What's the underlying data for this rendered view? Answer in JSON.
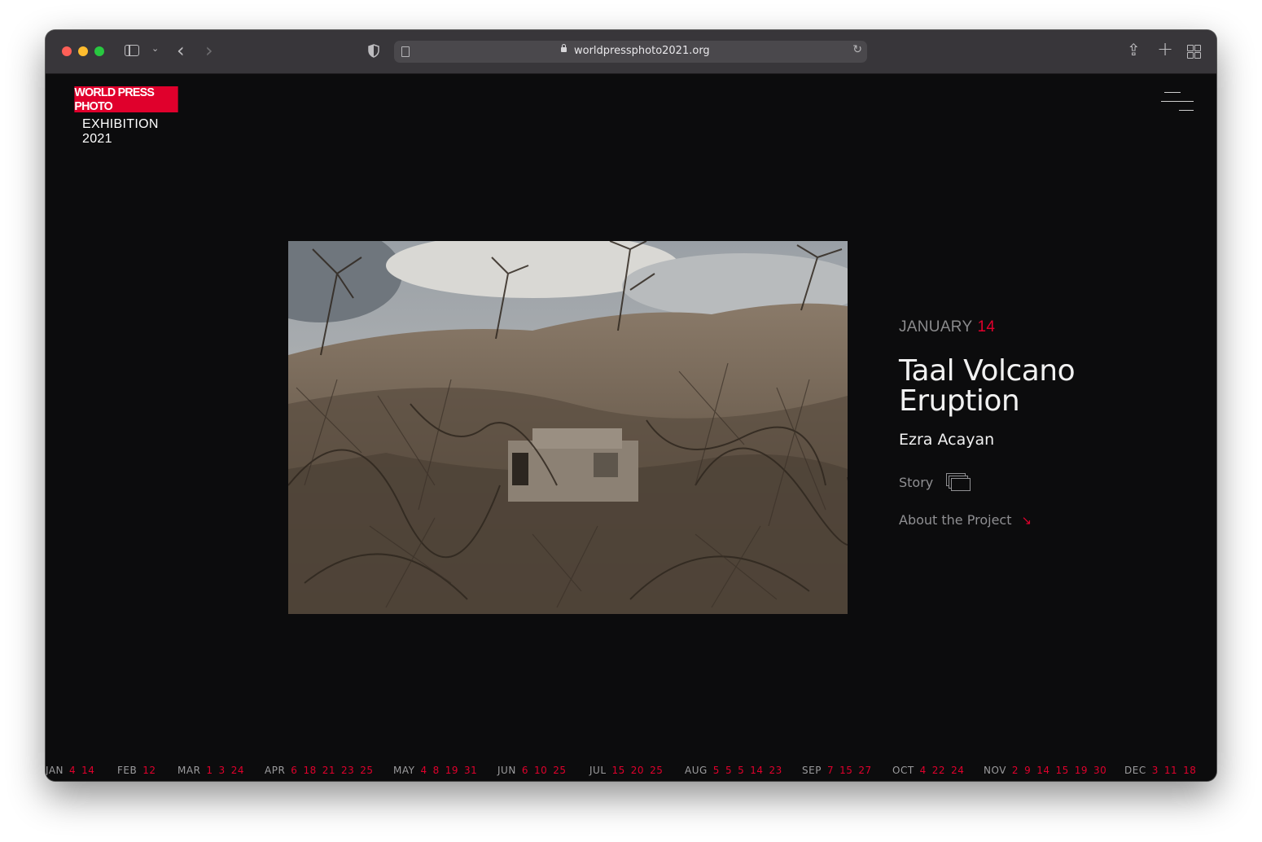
{
  "browser": {
    "url": "worldpressphoto2021.org"
  },
  "logo": {
    "brand": "WORLD PRESS PHOTO",
    "line1": "EXHIBITION",
    "line2": "2021"
  },
  "feature": {
    "month": "JANUARY",
    "day": "14",
    "title_line1": "Taal Volcano",
    "title_line2": "Eruption",
    "author": "Ezra Acayan",
    "story_label": "Story",
    "about_label": "About the Project"
  },
  "timeline": [
    {
      "month": "JAN",
      "days": [
        "4",
        "14"
      ]
    },
    {
      "month": "FEB",
      "days": [
        "12"
      ]
    },
    {
      "month": "MAR",
      "days": [
        "1",
        "3",
        "24"
      ]
    },
    {
      "month": "APR",
      "days": [
        "6",
        "18",
        "21",
        "23",
        "25"
      ]
    },
    {
      "month": "MAY",
      "days": [
        "4",
        "8",
        "19",
        "31"
      ]
    },
    {
      "month": "JUN",
      "days": [
        "6",
        "10",
        "25"
      ]
    },
    {
      "month": "JUL",
      "days": [
        "15",
        "20",
        "25"
      ]
    },
    {
      "month": "AUG",
      "days": [
        "5",
        "5",
        "5",
        "14",
        "23"
      ]
    },
    {
      "month": "SEP",
      "days": [
        "7",
        "15",
        "27"
      ]
    },
    {
      "month": "OCT",
      "days": [
        "4",
        "22",
        "24"
      ]
    },
    {
      "month": "NOV",
      "days": [
        "2",
        "9",
        "14",
        "15",
        "19",
        "30"
      ]
    },
    {
      "month": "DEC",
      "days": [
        "3",
        "11",
        "18"
      ]
    }
  ],
  "colors": {
    "accent": "#e0002c",
    "background": "#0c0c0d",
    "titlebar": "#38363a"
  },
  "icons": [
    "sidebar-icon",
    "chevron-down-icon",
    "back-icon",
    "forward-icon",
    "shield-icon",
    "lock-icon",
    "reload-icon",
    "share-icon",
    "plus-icon",
    "tab-grid-icon",
    "menu-icon",
    "stack-icon",
    "arrow-down-right-icon"
  ]
}
